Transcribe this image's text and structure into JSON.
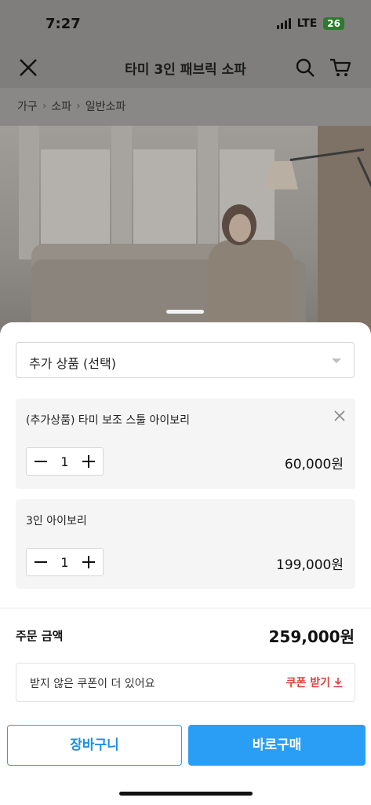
{
  "status_bar": {
    "time": "7:27",
    "network": "LTE",
    "battery": "26"
  },
  "header": {
    "title": "타미 3인 패브릭 소파"
  },
  "breadcrumb": [
    "가구",
    "소파",
    "일반소파"
  ],
  "options": {
    "select_label": "추가 상품 (선택)",
    "items": [
      {
        "name": "(추가상품) 타미 보조 스툴 아이보리",
        "quantity": "1",
        "price": "60,000원",
        "removable": true
      },
      {
        "name": "3인 아이보리",
        "quantity": "1",
        "price": "199,000원",
        "removable": false
      }
    ]
  },
  "order": {
    "total_label": "주문 금액",
    "total_value": "259,000원"
  },
  "coupon": {
    "message": "받지 않은 쿠폰이 더 있어요",
    "action": "쿠폰 받기"
  },
  "actions": {
    "cart": "장바구니",
    "buy": "바로구매"
  },
  "colors": {
    "accent": "#2a9df4",
    "coupon_red": "#e0413d"
  }
}
